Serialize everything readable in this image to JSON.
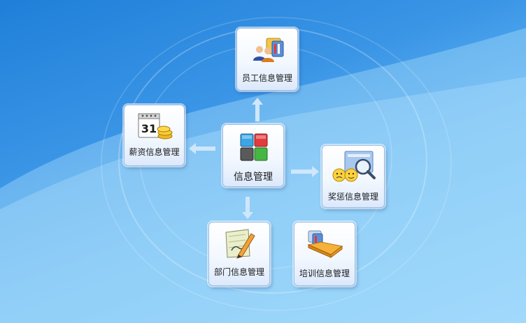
{
  "center": {
    "label": "信息管理",
    "icon": "colored-cubes-icon"
  },
  "modules": {
    "employee": {
      "label": "员工信息管理",
      "icon": "people-folder-icon"
    },
    "salary": {
      "label": "薪资信息管理",
      "icon": "calendar-coins-icon",
      "calendar_day": "31"
    },
    "reward": {
      "label": "奖惩信息管理",
      "icon": "faces-magnifier-icon"
    },
    "department": {
      "label": "部门信息管理",
      "icon": "pencil-notepad-icon"
    },
    "training": {
      "label": "培训信息管理",
      "icon": "orange-folder-icon"
    }
  },
  "colors": {
    "arrow": "#cfe6fb",
    "background_top": "#1f7fd8",
    "background_bottom": "#8fd2fa"
  }
}
